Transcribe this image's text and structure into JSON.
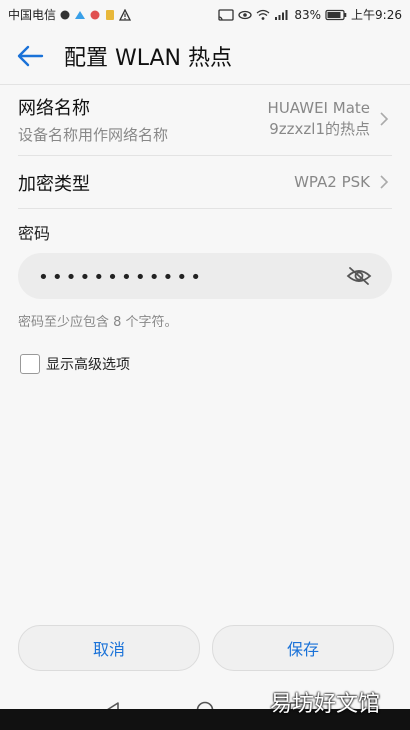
{
  "status": {
    "carrier": "中国电信",
    "battery": "83%",
    "time": "上午9:26"
  },
  "header": {
    "title": "配置 WLAN 热点"
  },
  "network_name": {
    "label": "网络名称",
    "sub": "设备名称用作网络名称",
    "value_line1": "HUAWEI Mate",
    "value_line2": "9zzxzl1的热点"
  },
  "encryption": {
    "label": "加密类型",
    "value": "WPA2 PSK"
  },
  "password": {
    "label": "密码",
    "value": "••••••••••••",
    "hint": "密码至少应包含 8 个字符。"
  },
  "advanced": {
    "label": "显示高级选项"
  },
  "buttons": {
    "cancel": "取消",
    "save": "保存"
  },
  "watermark": "易坊好文馆"
}
